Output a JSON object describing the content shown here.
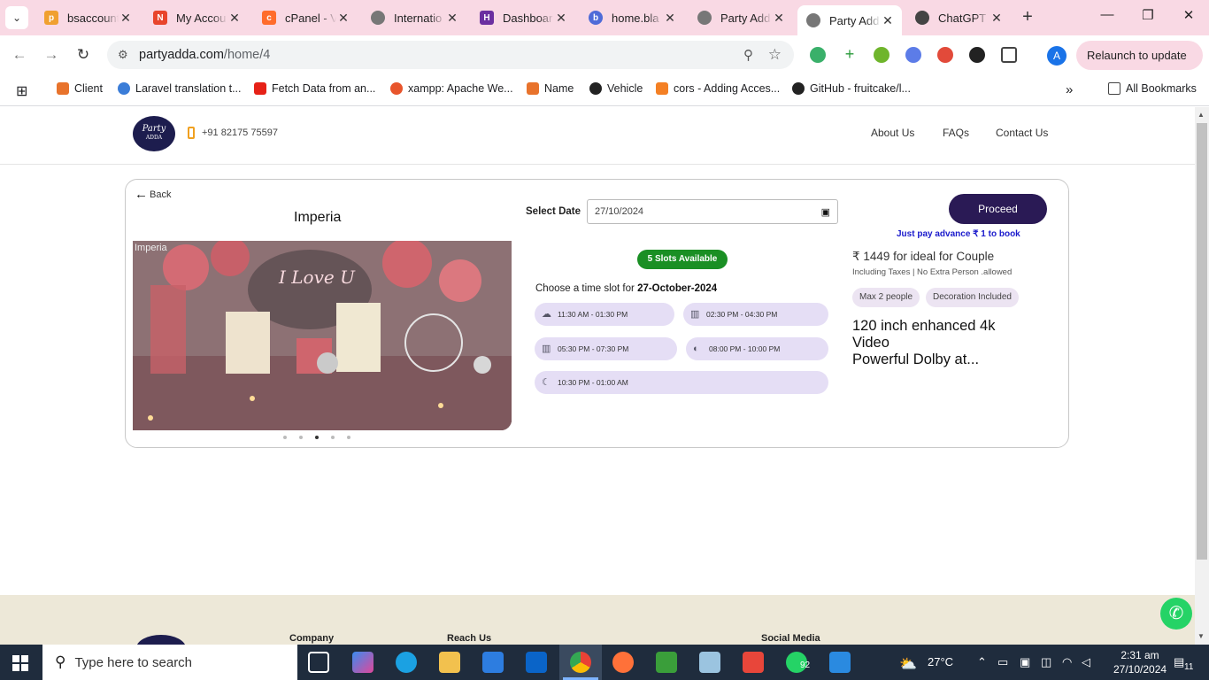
{
  "browser": {
    "tabs": [
      {
        "title": "bsaccount",
        "favicon": "phpmyadmin-icon",
        "color": "#f0a030"
      },
      {
        "title": "My Accou",
        "favicon": "n-logo-icon",
        "color": "#e8452c"
      },
      {
        "title": "cPanel - V",
        "favicon": "cpanel-icon",
        "color": "#ff6c2c"
      },
      {
        "title": "Internatio",
        "favicon": "globe-icon",
        "color": "#666666"
      },
      {
        "title": "Dashboar",
        "favicon": "h-logo-icon",
        "color": "#6b2fa0"
      },
      {
        "title": "home.bla",
        "favicon": "blade-icon",
        "color": "#4f6bd8"
      },
      {
        "title": "Party Add",
        "favicon": "globe-icon",
        "color": "#666666"
      },
      {
        "title": "Party Add",
        "favicon": "globe-icon",
        "color": "#666666"
      },
      {
        "title": "ChatGPT",
        "favicon": "chatgpt-icon",
        "color": "#444444"
      }
    ],
    "new_tab": "+",
    "url_host": "partyadda.com",
    "url_path": "/home/4",
    "relaunch_label": "Relaunch to update",
    "profile_initial": "A",
    "bookmarks": [
      {
        "label": "Client",
        "color": "#e8732c"
      },
      {
        "label": "Laravel translation t...",
        "color": "#3b7dd8"
      },
      {
        "label": "Fetch Data from an...",
        "color": "#e62117"
      },
      {
        "label": "xampp: Apache We...",
        "color": "#e8552c"
      },
      {
        "label": "Name",
        "color": "#e8732c"
      },
      {
        "label": "Vehicle",
        "color": "#222222"
      },
      {
        "label": "cors - Adding Acces...",
        "color": "#f48024"
      },
      {
        "label": "GitHub - fruitcake/l...",
        "color": "#222222"
      }
    ],
    "all_bookmarks": "All Bookmarks"
  },
  "site": {
    "logo_text_1": "Party",
    "logo_text_2": "ADDA",
    "phone": "+91 82175 75597",
    "nav": [
      "About Us",
      "FAQs",
      "Contact Us"
    ]
  },
  "booking": {
    "back_label": "Back",
    "venue_name": "Imperia",
    "image_alt": "Imperia",
    "image_caption": "I Love U",
    "select_date_label": "Select Date",
    "date_value": "27/10/2024",
    "slots_badge": "5 Slots Available",
    "choose_prefix": "Choose a time slot for ",
    "choose_date": "27-October-2024",
    "slots": [
      {
        "label": "11:30 AM - 01:30 PM",
        "icon": "cloud-icon"
      },
      {
        "label": "02:30 PM - 04:30 PM",
        "icon": "city-icon"
      },
      {
        "label": "05:30 PM - 07:30 PM",
        "icon": "city-icon"
      },
      {
        "label": "08:00 PM - 10:00 PM",
        "icon": "moon-icon"
      },
      {
        "label": "10:30 PM - 01:00 AM",
        "icon": "night-cloud-icon"
      }
    ],
    "proceed_label": "Proceed",
    "advance_text": "Just pay advance ₹ 1 to book",
    "price_text": "₹ 1449 for ideal for Couple",
    "taxes_text": "Including Taxes | No Extra Person .allowed",
    "chips": [
      "Max 2 people",
      "Decoration Included"
    ],
    "feature_line1": "120 inch enhanced 4k",
    "feature_line2": "Video",
    "feature_line3": "Powerful Dolby at...",
    "carousel_count": 5,
    "carousel_active": 3
  },
  "footer": {
    "headings": [
      "Company",
      "Reach Us",
      "Social Media"
    ]
  },
  "taskbar": {
    "search_placeholder": "Type here to search",
    "weather": "27°C",
    "time": "2:31 am",
    "date": "27/10/2024",
    "whatsapp_badge": "92",
    "notif_count": "11"
  },
  "colors": {
    "primary": "#2a1a55",
    "slot_bg": "#e5def5",
    "badge_green": "#1a8f24",
    "tab_strip": "#f9d9e4"
  }
}
